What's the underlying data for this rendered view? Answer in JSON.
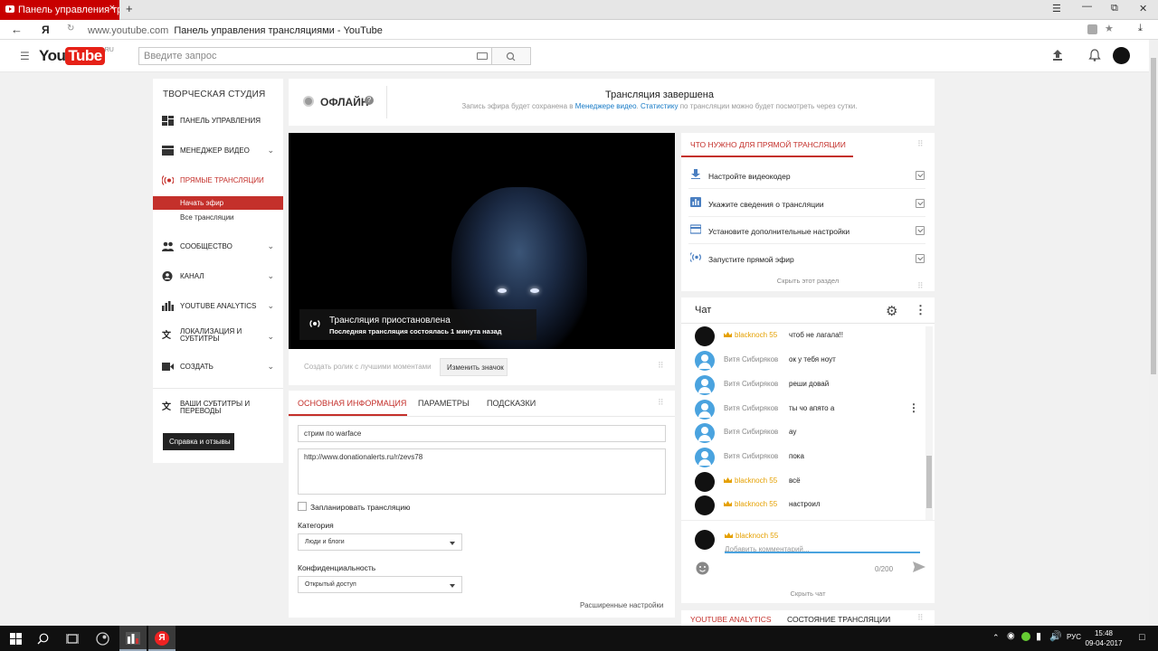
{
  "browser": {
    "tab_title": "Панель управления тра",
    "tab_close": "×",
    "new_tab": "+",
    "yandex_logo": "Я",
    "url_domain": "www.youtube.com",
    "page_title": "Панель управления трансляциями - YouTube"
  },
  "header": {
    "logo_you": "You",
    "logo_tube": "Tube",
    "logo_region": "RU",
    "search_placeholder": "Введите запрос"
  },
  "sidebar": {
    "heading": "ТВОРЧЕСКАЯ СТУДИЯ",
    "items": [
      {
        "label": "ПАНЕЛЬ УПРАВЛЕНИЯ",
        "icon": "dashboard-icon"
      },
      {
        "label": "МЕНЕДЖЕР ВИДЕО",
        "icon": "video-manager-icon"
      },
      {
        "label": "ПРЯМЫЕ ТРАНСЛЯЦИИ",
        "icon": "live-icon"
      },
      {
        "label": "СООБЩЕСТВО",
        "icon": "community-icon"
      },
      {
        "label": "КАНАЛ",
        "icon": "channel-icon"
      },
      {
        "label": "YOUTUBE ANALYTICS",
        "icon": "analytics-icon"
      },
      {
        "label": "ЛОКАЛИЗАЦИЯ И СУБТИТРЫ",
        "icon": "translate-icon"
      },
      {
        "label": "СОЗДАТЬ",
        "icon": "create-icon"
      },
      {
        "label": "ВАШИ СУБТИТРЫ И ПЕРЕВОДЫ",
        "icon": "subtitles-icon"
      }
    ],
    "sub_active": "Начать эфир",
    "sub_all": "Все трансляции",
    "help_button": "Справка и отзывы"
  },
  "status": {
    "state": "ОФЛАЙН",
    "help": "?",
    "title": "Трансляция завершена",
    "note_prefix": "Запись эфира будет сохранена в",
    "note_link1": "Менеджере видео",
    "note_link2": "Статистику",
    "note_suffix": "по трансляции можно будет посмотреть через сутки."
  },
  "video": {
    "overlay_title": "Трансляция приостановлена",
    "overlay_sub": "Последняя трансляция состоялась 1 минута назад",
    "clip_placeholder": "Создать ролик с лучшими моментами",
    "change_thumb": "Изменить значок"
  },
  "info": {
    "tabs": [
      "ОСНОВНАЯ ИНФОРМАЦИЯ",
      "ПАРАМЕТРЫ",
      "ПОДСКАЗКИ"
    ],
    "title_value": "стрим по warface",
    "description_value": "http://www.donationalerts.ru/r/zevs78",
    "schedule_label": "Запланировать трансляцию",
    "category_label": "Категория",
    "category_value": "Люди и блоги",
    "privacy_label": "Конфиденциальность",
    "privacy_value": "Открытый доступ",
    "advanced_link": "Расширенные настройки"
  },
  "checklist": {
    "title": "ЧТО НУЖНО ДЛЯ ПРЯМОЙ ТРАНСЛЯЦИИ",
    "items": [
      {
        "label": "Настройте видеокодер",
        "icon": "download-icon"
      },
      {
        "label": "Укажите сведения о трансляции",
        "icon": "info-chart-icon"
      },
      {
        "label": "Установите дополнительные настройки",
        "icon": "card-icon"
      },
      {
        "label": "Запустите прямой эфир",
        "icon": "live-icon"
      }
    ],
    "hide": "Скрыть этот раздел"
  },
  "chat": {
    "title": "Чат",
    "messages": [
      {
        "author": "blacknoch 55",
        "text": "чтоб не лагала!!",
        "owner": true
      },
      {
        "author": "Витя Сибиряков",
        "text": "ок у тебя ноут",
        "owner": false
      },
      {
        "author": "Витя Сибиряков",
        "text": "реши довай",
        "owner": false
      },
      {
        "author": "Витя Сибиряков",
        "text": "ты чо апято а",
        "owner": false
      },
      {
        "author": "Витя Сибиряков",
        "text": "ау",
        "owner": false
      },
      {
        "author": "Витя Сибиряков",
        "text": "пока",
        "owner": false
      },
      {
        "author": "blacknoch 55",
        "text": "всё",
        "owner": true
      },
      {
        "author": "blacknoch 55",
        "text": "настроил",
        "owner": true
      }
    ],
    "input_author": "blacknoch 55",
    "input_placeholder": "Добавить комментарий...",
    "counter": "0/200",
    "hide": "Скрыть чат"
  },
  "bottom": {
    "analytics": "YOUTUBE ANALYTICS",
    "status": "СОСТОЯНИЕ ТРАНСЛЯЦИИ"
  },
  "taskbar": {
    "lang": "РУС",
    "time": "15:48",
    "date": "09-04-2017"
  },
  "colors": {
    "accent": "#c4302b",
    "link": "#167ac6",
    "owner_name": "#e5a000"
  }
}
